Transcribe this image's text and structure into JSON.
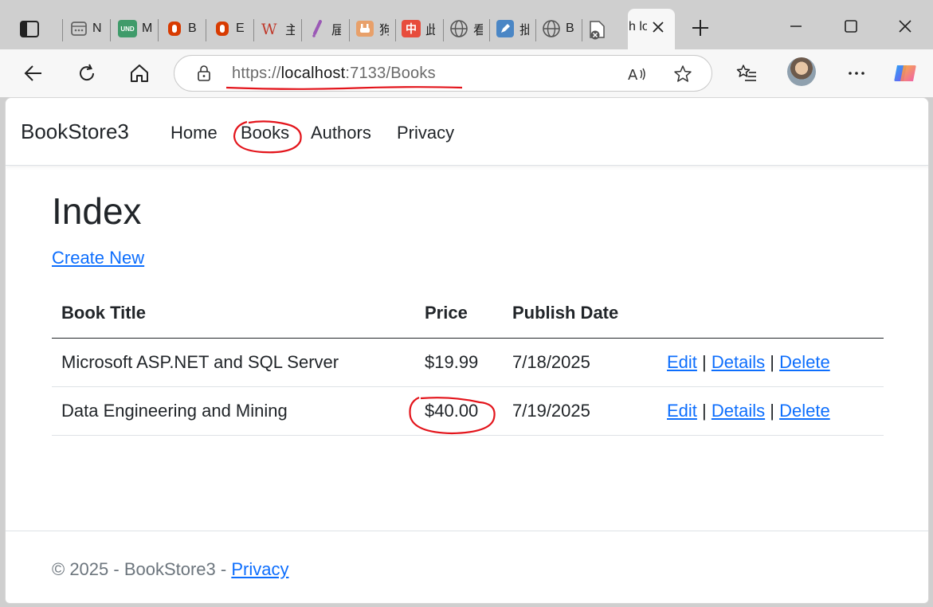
{
  "browser": {
    "tabs": [
      {
        "title": "N",
        "icon": "calendar-icon",
        "color": "#9a9a9a"
      },
      {
        "title": "M",
        "icon": "und-icon",
        "color": "#3f9b6a"
      },
      {
        "title": "B",
        "icon": "office-icon",
        "color": "#d83b01"
      },
      {
        "title": "E",
        "icon": "office-icon",
        "color": "#d83b01"
      },
      {
        "title": "主",
        "icon": "w-icon",
        "color": "#c0392b"
      },
      {
        "title": "届",
        "icon": "slash-icon",
        "color": "#8e44ad"
      },
      {
        "title": "狗",
        "icon": "plug-icon",
        "color": "#e67e22"
      },
      {
        "title": "此",
        "icon": "chinese-icon",
        "color": "#e74c3c"
      },
      {
        "title": "看",
        "icon": "globe-icon",
        "color": "#666666"
      },
      {
        "title": "批",
        "icon": "edit-icon",
        "color": "#3b79b8"
      },
      {
        "title": "B",
        "icon": "globe-icon",
        "color": "#666666"
      }
    ],
    "active_tab": {
      "title": "h lo"
    },
    "address": {
      "url_scheme": "https://",
      "url_host": "localhost",
      "url_rest": ":7133/Books"
    }
  },
  "site": {
    "brand": "BookStore3",
    "nav": {
      "home": "Home",
      "books": "Books",
      "authors": "Authors",
      "privacy": "Privacy"
    }
  },
  "main": {
    "heading": "Index",
    "create_link": "Create New",
    "columns": {
      "title": "Book Title",
      "price": "Price",
      "date": "Publish Date"
    },
    "rows": [
      {
        "title": "Microsoft ASP.NET and SQL Server",
        "price": "$19.99",
        "date": "7/18/2025",
        "edit": "Edit",
        "details": "Details",
        "delete": "Delete",
        "sep": "|"
      },
      {
        "title": "Data Engineering and Mining",
        "price": "$40.00",
        "date": "7/19/2025",
        "edit": "Edit",
        "details": "Details",
        "delete": "Delete",
        "sep": "|"
      }
    ]
  },
  "footer": {
    "copyright": "© 2025 - BookStore3 - ",
    "privacy": "Privacy"
  },
  "colors": {
    "link": "#0d6efd",
    "annotation": "#e3141b",
    "text": "#212529"
  }
}
